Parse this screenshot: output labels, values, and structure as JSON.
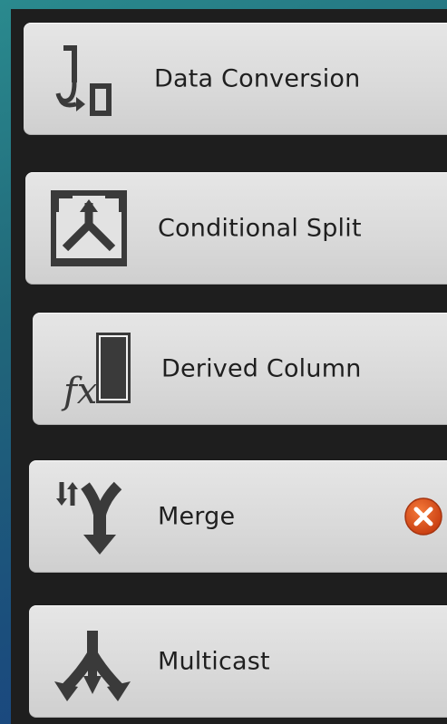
{
  "toolbox": {
    "items": [
      {
        "label": "Data Conversion",
        "icon": "data-conversion-icon"
      },
      {
        "label": "Conditional Split",
        "icon": "conditional-split-icon"
      },
      {
        "label": "Derived Column",
        "icon": "derived-column-icon",
        "icon_text": "fx"
      },
      {
        "label": "Merge",
        "icon": "merge-icon",
        "status": "error",
        "status_icon": "error-icon"
      },
      {
        "label": "Multicast",
        "icon": "multicast-icon"
      }
    ]
  },
  "colors": {
    "tile": "#d9d9d9",
    "panel": "#1e1e1e",
    "icon": "#3a3a3a",
    "error": "#e0501a"
  }
}
